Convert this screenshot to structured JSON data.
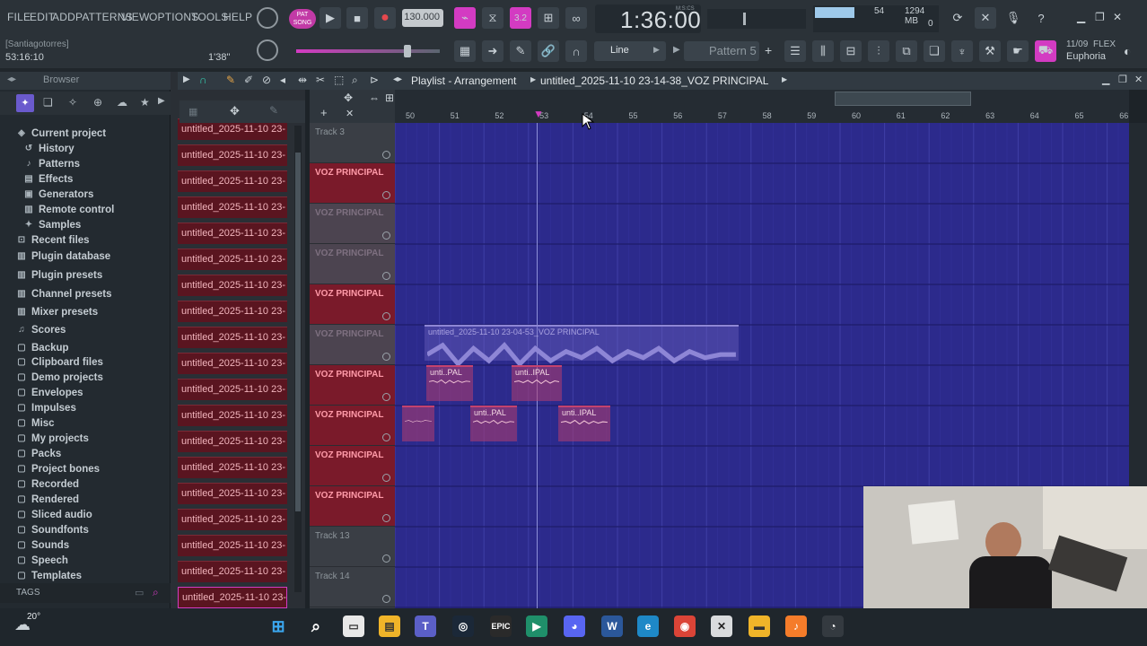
{
  "menu": {
    "items": [
      "FILE",
      "EDIT",
      "ADD",
      "PATTERNS",
      "VIEW",
      "OPTIONS",
      "TOOLS",
      "HELP"
    ]
  },
  "transport": {
    "tempo": "130.000",
    "time": "1:36:00",
    "time_unit": "M:S:CS",
    "pat_label": "PAT",
    "song_label": "SONG",
    "cpu": "54",
    "memory": "1294 MB",
    "voices": "0"
  },
  "status": {
    "user": "[Santiagotorres]",
    "clock": "53:16:10",
    "length": "1'38\""
  },
  "toolbar": {
    "snap": "Line",
    "pattern": "Pattern 5",
    "flex_date": "11/09",
    "flex_label": "FLEX",
    "flex_preset": "Euphoria"
  },
  "browser": {
    "title": "Browser",
    "items": [
      "Current project",
      "History",
      "Patterns",
      "Effects",
      "Generators",
      "Remote control",
      "Samples",
      "Recent files",
      "Plugin database",
      "Plugin presets",
      "Channel presets",
      "Mixer presets",
      "Scores",
      "Backup",
      "Clipboard files",
      "Demo projects",
      "Envelopes",
      "Impulses",
      "Misc",
      "My projects",
      "Packs",
      "Project bones",
      "Recorded",
      "Rendered",
      "Sliced audio",
      "Soundfonts",
      "Sounds",
      "Speech",
      "Templates"
    ],
    "tags_label": "TAGS"
  },
  "picker": {
    "clip_label": "untitled_2025-11-10 23-",
    "count": 19
  },
  "playlist": {
    "title": "Playlist - Arrangement",
    "project": "untitled_2025-11-10 23-14-38_VOZ PRINCIPAL",
    "ruler": [
      "50",
      "51",
      "52",
      "53",
      "54",
      "55",
      "56",
      "57",
      "58",
      "59",
      "60",
      "61",
      "62",
      "63",
      "64",
      "65",
      "66"
    ],
    "tracks": [
      {
        "label": "Track 3",
        "kind": "plain"
      },
      {
        "label": "VOZ PRINCIPAL",
        "kind": "active"
      },
      {
        "label": "VOZ PRINCIPAL",
        "kind": "muted"
      },
      {
        "label": "VOZ PRINCIPAL",
        "kind": "muted"
      },
      {
        "label": "VOZ PRINCIPAL",
        "kind": "active"
      },
      {
        "label": "VOZ PRINCIPAL",
        "kind": "muted"
      },
      {
        "label": "VOZ PRINCIPAL",
        "kind": "active"
      },
      {
        "label": "VOZ PRINCIPAL",
        "kind": "active"
      },
      {
        "label": "VOZ PRINCIPAL",
        "kind": "active"
      },
      {
        "label": "VOZ PRINCIPAL",
        "kind": "active"
      },
      {
        "label": "Track 13",
        "kind": "plain"
      },
      {
        "label": "Track 14",
        "kind": "plain"
      }
    ],
    "clips": {
      "long": "untitled_2025-11-10 23-04-53_VOZ PRINCIPAL",
      "c1": "unti..PAL",
      "c2": "unti..IPAL",
      "c3": "unti..PAL",
      "c4": "unti..IPAL"
    }
  },
  "taskbar": {
    "weather": "20°"
  },
  "colors": {
    "grid": "#2c2a8c",
    "clip": "#c4426f",
    "track_active": "#7a1a2a",
    "accent": "#ff4fd8"
  }
}
